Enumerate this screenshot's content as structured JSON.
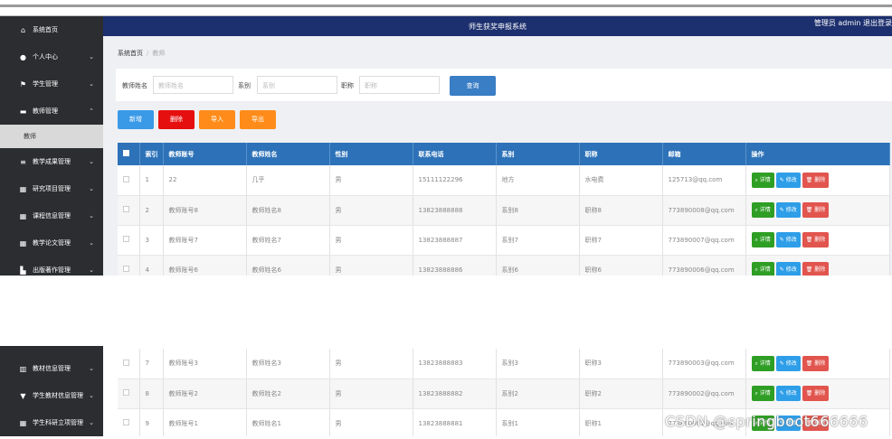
{
  "topbar": {
    "title": "师生获奖申报系统",
    "user": "管理员 admin  退出登录"
  },
  "sidebar": {
    "items_top": [
      {
        "label": "系统首页",
        "icon": "home-icon",
        "glyph": "⌂",
        "chev": ""
      },
      {
        "label": "个人中心",
        "icon": "user-icon",
        "glyph": "●",
        "chev": "⌄"
      },
      {
        "label": "学生管理",
        "icon": "flag-icon",
        "glyph": "⚑",
        "chev": "⌄"
      },
      {
        "label": "教师管理",
        "icon": "monitor-icon",
        "glyph": "▬",
        "chev": "⌃"
      }
    ],
    "sub_item": "教师",
    "items_bottom": [
      {
        "label": "教学成果管理",
        "icon": "list-icon",
        "glyph": "≡",
        "chev": "⌄"
      },
      {
        "label": "研究项目管理",
        "icon": "grid-icon",
        "glyph": "▦",
        "chev": "⌄"
      },
      {
        "label": "课程信息管理",
        "icon": "grid-icon",
        "glyph": "▦",
        "chev": "⌄"
      },
      {
        "label": "教学论文管理",
        "icon": "grid-icon",
        "glyph": "▦",
        "chev": "⌄"
      },
      {
        "label": "出版著作管理",
        "icon": "briefcase-icon",
        "glyph": "▙",
        "chev": "⌄"
      }
    ],
    "items_lower": [
      {
        "label": "教材信息管理",
        "icon": "book-icon",
        "glyph": "▥",
        "chev": "⌄"
      },
      {
        "label": "学生教材信息管理",
        "icon": "trophy-icon",
        "glyph": "▼",
        "chev": "⌄"
      },
      {
        "label": "学生科研立项管理",
        "icon": "grid-icon",
        "glyph": "▦",
        "chev": "⌄"
      }
    ]
  },
  "breadcrumb": {
    "home": "系统首页",
    "current": "教师"
  },
  "filters": {
    "name_label": "教师姓名",
    "name_placeholder": "教师姓名",
    "dept_label": "系别",
    "dept_placeholder": "系别",
    "title_label": "职称",
    "title_placeholder": "职称",
    "search_button": "查询"
  },
  "actions": {
    "add": "新增",
    "delete": "删除",
    "import": "导入",
    "export": "导出"
  },
  "table": {
    "headers": [
      "索引",
      "教师账号",
      "教师姓名",
      "性别",
      "联系电话",
      "系别",
      "职称",
      "邮箱",
      "操作"
    ],
    "ops": {
      "detail": "详情",
      "edit": "修改",
      "delete": "删除"
    },
    "rows_top": [
      [
        "1",
        "22",
        "几乎",
        "男",
        "15111122296",
        "地方",
        "水电费",
        "125713@qq.com"
      ],
      [
        "2",
        "教师账号8",
        "教师姓名8",
        "男",
        "13823888888",
        "系别8",
        "职称8",
        "773890008@qq.com"
      ],
      [
        "3",
        "教师账号7",
        "教师姓名7",
        "男",
        "13823888887",
        "系别7",
        "职称7",
        "773890007@qq.com"
      ],
      [
        "4",
        "教师账号6",
        "教师姓名6",
        "男",
        "13823888886",
        "系别6",
        "职称6",
        "773890006@qq.com"
      ]
    ],
    "rows_bottom": [
      [
        "7",
        "教师账号3",
        "教师姓名3",
        "男",
        "13823888883",
        "系别3",
        "职称3",
        "773890003@qq.com"
      ],
      [
        "8",
        "教师账号2",
        "教师姓名2",
        "男",
        "13823888882",
        "系别2",
        "职称2",
        "773890002@qq.com"
      ],
      [
        "9",
        "教师账号1",
        "教师姓名1",
        "男",
        "13823888881",
        "系别1",
        "职称1",
        "773890001@qq.com"
      ]
    ]
  },
  "watermark": "CSDN @springboot666666",
  "colors": {
    "sidebar": "#2b2d30",
    "topbar": "#1c2f6e",
    "table_header": "#2d72b8",
    "add": "#3a9ae8",
    "delete": "#e60f0f",
    "import": "#ff8c1a",
    "detail": "#2e9e24",
    "edit": "#2e9ee8",
    "remove": "#e1554e"
  }
}
